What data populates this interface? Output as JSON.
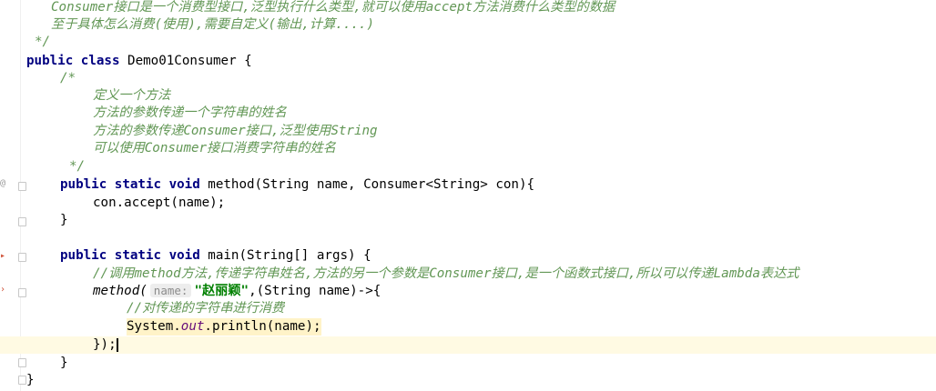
{
  "editor": {
    "lines": {
      "l1_a": "Consumer",
      "l1_b": "接口是一个消费型接口,泛型执行什么类型,就可以使用",
      "l1_c": "accept",
      "l1_d": "方法消费什么类型的数据",
      "l2": "至于具体怎么消费(使用),需要自定义(输出,计算....)",
      "l3": "*/",
      "l4_kw": "public class",
      "l4_rest": " Demo01Consumer {",
      "l5": "/*",
      "l6": "定义一个方法",
      "l7": "方法的参数传递一个字符串的姓名",
      "l8_a": "方法的参数传递",
      "l8_b": "Consumer",
      "l8_c": "接口,泛型使用",
      "l8_d": "String",
      "l9_a": "可以使用",
      "l9_b": "Consumer",
      "l9_c": "接口消费字符串的姓名",
      "l10": "*/",
      "l11_kw": "public static void",
      "l11_rest": " method(String name, Consumer<String> con){",
      "l12": "con.accept(name);",
      "l13": "}",
      "l14_kw": "public static void",
      "l14_rest": " main(String[] args) {",
      "l15_a": "//调用",
      "l15_b": "method",
      "l15_c": "方法,传递字符串姓名,方法的另一个参数是",
      "l15_d": "Consumer",
      "l15_e": "接口,是一个函数式接口,所以可以传递",
      "l15_f": "Lambda",
      "l15_g": "表达式",
      "l16_call": "method(",
      "l16_hint": "name:",
      "l16_str": "\"赵丽颖\"",
      "l16_rest": ",(String name)->{",
      "l17": "//对传递的字符串进行消费",
      "l18_a": "System.",
      "l18_b": "out",
      "l18_c": ".println(",
      "l18_d": "name",
      "l18_e": ");",
      "l19": "});",
      "l20": "}",
      "l21": "}"
    }
  }
}
